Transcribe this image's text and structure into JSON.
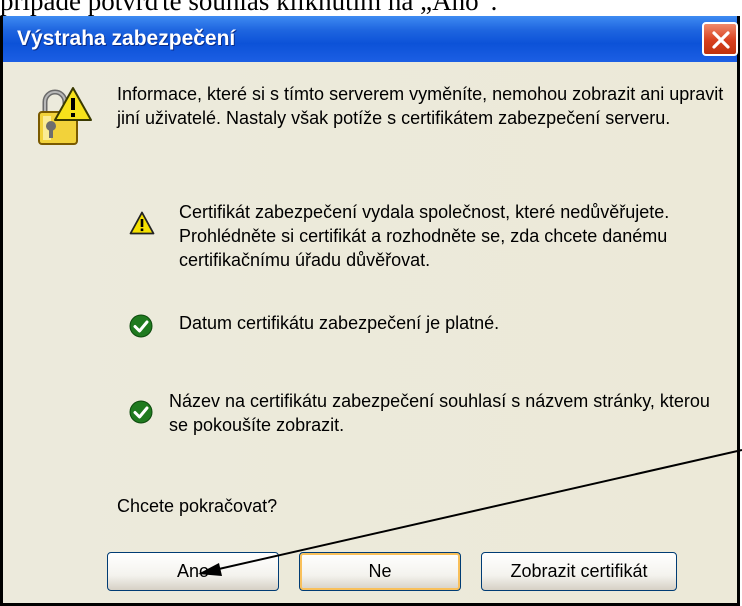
{
  "document": {
    "partial_text": "případě potvrďte souhlas kliknutím na „Ano“."
  },
  "dialog": {
    "title": "Výstraha zabezpečení",
    "intro": "Informace, které si s tímto serverem vyměníte, nemohou zobrazit ani upravit jiní uživatelé. Nastaly však potíže s certifikátem zabezpečení serveru.",
    "items": [
      {
        "icon": "warning-icon",
        "text": "Certifikát zabezpečení vydala společnost, které nedůvěřujete. Prohlédněte si certifikát a rozhodněte se, zda chcete danému certifikačnímu úřadu důvěřovat."
      },
      {
        "icon": "check-icon",
        "text": "Datum certifikátu zabezpečení je platné."
      },
      {
        "icon": "check-icon",
        "text": "Název na certifikátu zabezpečení souhlasí s názvem stránky, kterou se pokoušíte zobrazit."
      }
    ],
    "question": "Chcete pokračovat?",
    "buttons": {
      "yes": "Ano",
      "no": "Ne",
      "view_certificate": "Zobrazit certifikát"
    }
  },
  "colors": {
    "titlebar": "#0c52d8",
    "close_button": "#d8401e",
    "dialog_bg": "#ece9d8",
    "check": "#1f7a1f",
    "warning": "#f5e100"
  }
}
